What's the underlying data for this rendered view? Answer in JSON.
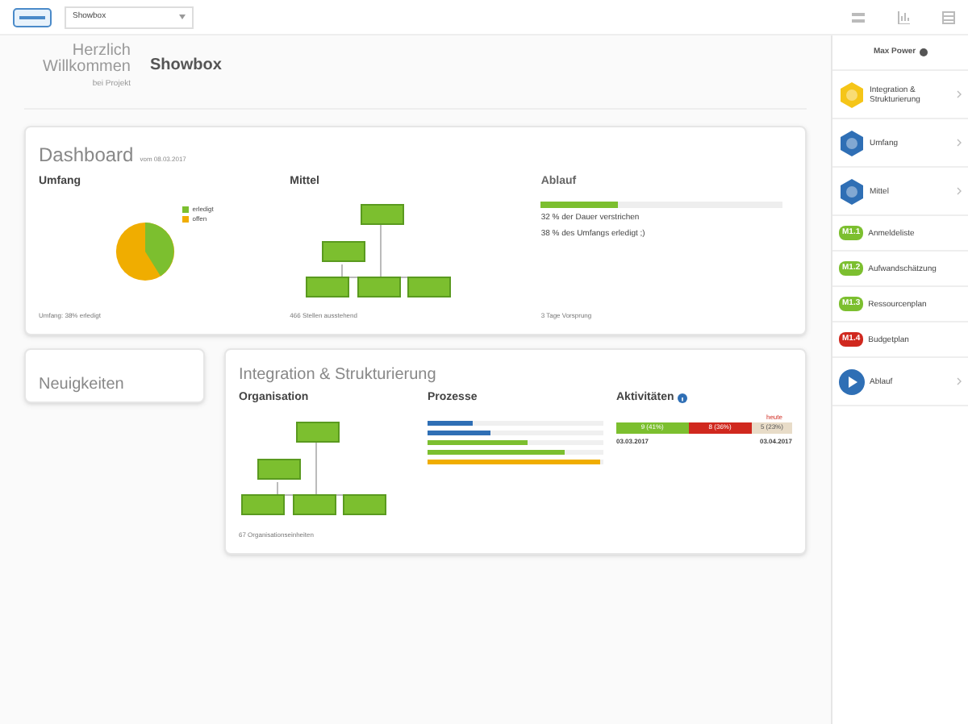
{
  "topbar": {
    "project_select": "Showbox"
  },
  "header": {
    "greeting": "Herzlich Willkommen",
    "subtitle": "bei Projekt",
    "project": "Showbox"
  },
  "dashboard": {
    "title": "Dashboard",
    "date": "vom 08.03.2017",
    "umfang": {
      "title": "Umfang",
      "legend": [
        {
          "label": "erledigt",
          "color": "#7cbf2f"
        },
        {
          "label": "offen",
          "color": "#f0ad00"
        }
      ],
      "footer": "Umfang: 38% erledigt"
    },
    "mittel": {
      "title": "Mittel",
      "footer": "466 Stellen ausstehend"
    },
    "ablauf": {
      "title": "Ablauf",
      "level": 0.32,
      "lines": [
        "32 % der Dauer verstrichen",
        "38 % des Umfangs erledigt ;)"
      ],
      "footer": "3 Tage Vorsprung"
    }
  },
  "news": {
    "title": "Neuigkeiten"
  },
  "integration": {
    "title": "Integration & Strukturierung",
    "organisation": {
      "title": "Organisation",
      "footer": "67 Organisationseinheiten"
    },
    "prozesse": {
      "title": "Prozesse",
      "bars": [
        {
          "level": 0.26,
          "color": "#2f6fb5"
        },
        {
          "level": 0.36,
          "color": "#2f6fb5"
        },
        {
          "level": 0.57,
          "color": "#7cbf2f"
        },
        {
          "level": 0.78,
          "color": "#7cbf2f"
        },
        {
          "level": 0.98,
          "color": "#f0ad00"
        }
      ]
    },
    "aktivitaeten": {
      "title": "Aktivitäten",
      "today": "heute",
      "segments": [
        {
          "label": "9 (41%)",
          "color": "#7cbf2f"
        },
        {
          "label": "8 (36%)",
          "color": "#d0281e"
        },
        {
          "label": "5 (23%)",
          "color": "#e8dcc8"
        }
      ],
      "start": "03.03.2017",
      "end": "03.04.2017"
    }
  },
  "sidebar": {
    "user": "Max Power",
    "items": [
      {
        "kind": "phase",
        "label": "Integration & Strukturierung",
        "color": "#f5c518",
        "chevron": true
      },
      {
        "kind": "phase",
        "label": "Umfang",
        "color": "#2f6fb5",
        "chevron": true
      },
      {
        "kind": "phase",
        "label": "Mittel",
        "color": "#2f6fb5",
        "chevron": true
      },
      {
        "kind": "task",
        "badge": "M1.1",
        "label": "Anmeldeliste",
        "color": "#7cbf2f"
      },
      {
        "kind": "task",
        "badge": "M1.2",
        "label": "Aufwandschätzung",
        "color": "#7cbf2f"
      },
      {
        "kind": "task",
        "badge": "M1.3",
        "label": "Ressourcenplan",
        "color": "#7cbf2f"
      },
      {
        "kind": "task",
        "badge": "M1.4",
        "label": "Budgetplan",
        "color": "#d0281e"
      },
      {
        "kind": "play",
        "label": "Ablauf",
        "color": "#2f6fb5",
        "chevron": true
      }
    ]
  }
}
